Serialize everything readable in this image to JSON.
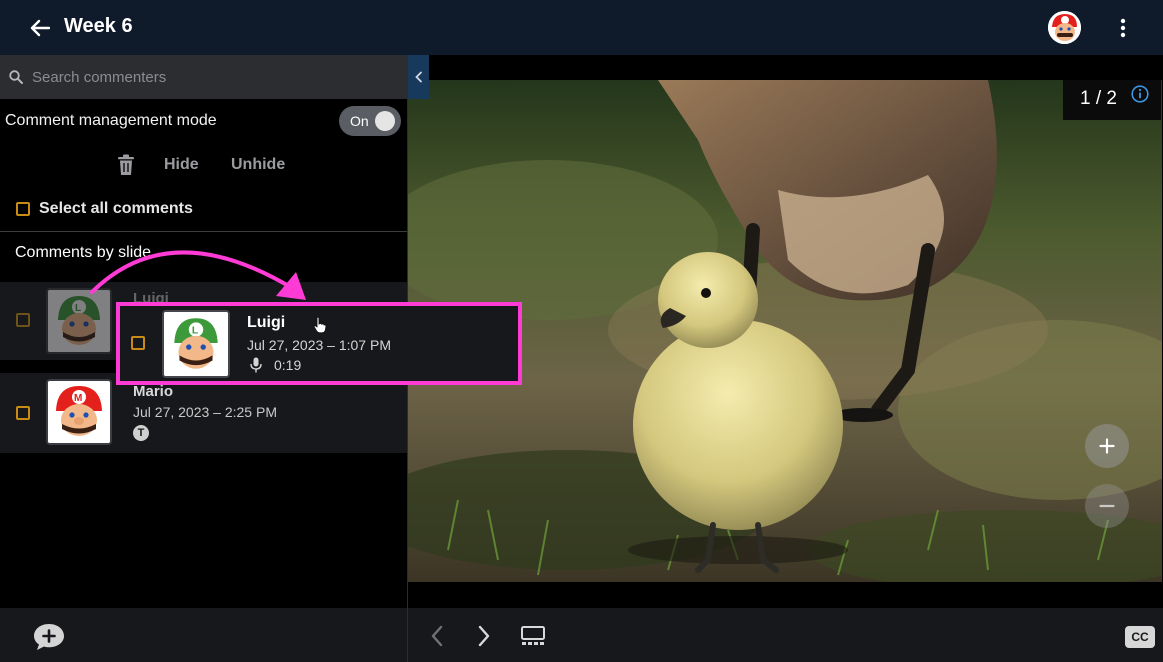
{
  "header": {
    "title": "Week 6",
    "back_icon": "arrow-left-icon",
    "menu_icon": "kebab-menu-icon"
  },
  "sidebar": {
    "search": {
      "placeholder": "Search commenters",
      "value": ""
    },
    "comment_management_mode": {
      "label": "Comment management mode",
      "toggle_label": "On",
      "enabled": true
    },
    "actions": {
      "delete_icon": "trash-icon",
      "hide_label": "Hide",
      "unhide_label": "Unhide"
    },
    "select_all_label": "Select all comments",
    "section_title": "Comments by slide",
    "comments": [
      {
        "name": "Luigi",
        "date": "Jul 27, 2023 – 1:07 PM",
        "type": "audio",
        "duration": "0:19",
        "avatar": "luigi"
      },
      {
        "name": "Mario",
        "date": "Jul 27, 2023 – 2:25 PM",
        "type": "text",
        "type_badge": "T",
        "avatar": "mario"
      }
    ],
    "add_comment_icon": "add-comment-icon"
  },
  "viewer": {
    "slide_counter": "1 / 2",
    "info_icon": "info-icon",
    "zoom_in_icon": "plus-icon",
    "zoom_out_icon": "minus-icon",
    "prev_icon": "chevron-left-icon",
    "next_icon": "chevron-right-icon",
    "grid_icon": "slides-grid-icon",
    "cc_label": "CC"
  },
  "colors": {
    "header_bg": "#0f1a2b",
    "checkbox": "#c88b16",
    "highlight": "#ff3bd6",
    "collapse_tab": "#173a5c"
  }
}
